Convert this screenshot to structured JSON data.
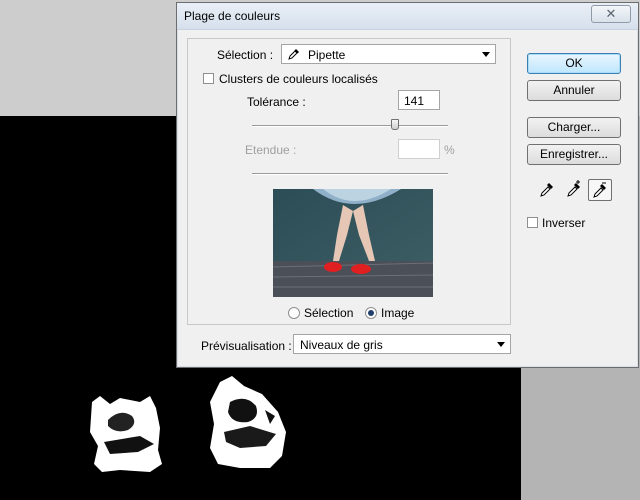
{
  "dialog": {
    "title": "Plage de couleurs",
    "close_glyph": "✕"
  },
  "selection": {
    "label": "Sélection :",
    "value": "Pipette",
    "icon": "eyedropper-icon"
  },
  "clusters": {
    "label": "Clusters de couleurs localisés",
    "checked": false
  },
  "tolerance": {
    "label": "Tolérance :",
    "value": "141",
    "slider_fraction": 0.73
  },
  "etendue": {
    "label": "Etendue :",
    "value": "",
    "unit": "%",
    "disabled": true
  },
  "preview_mode": {
    "selection_label": "Sélection",
    "image_label": "Image",
    "selected": "Image"
  },
  "previsualisation": {
    "label": "Prévisualisation :",
    "value": "Niveaux de gris"
  },
  "buttons": {
    "ok": "OK",
    "annuler": "Annuler",
    "charger": "Charger...",
    "enregistrer": "Enregistrer..."
  },
  "droppers": [
    "eyedropper-icon",
    "eyedropper-plus-icon",
    "eyedropper-minus-icon"
  ],
  "inverser": {
    "label": "Inverser",
    "checked": false
  },
  "colors": {
    "accent": "#3c7fb1",
    "canvas": "#000000"
  }
}
